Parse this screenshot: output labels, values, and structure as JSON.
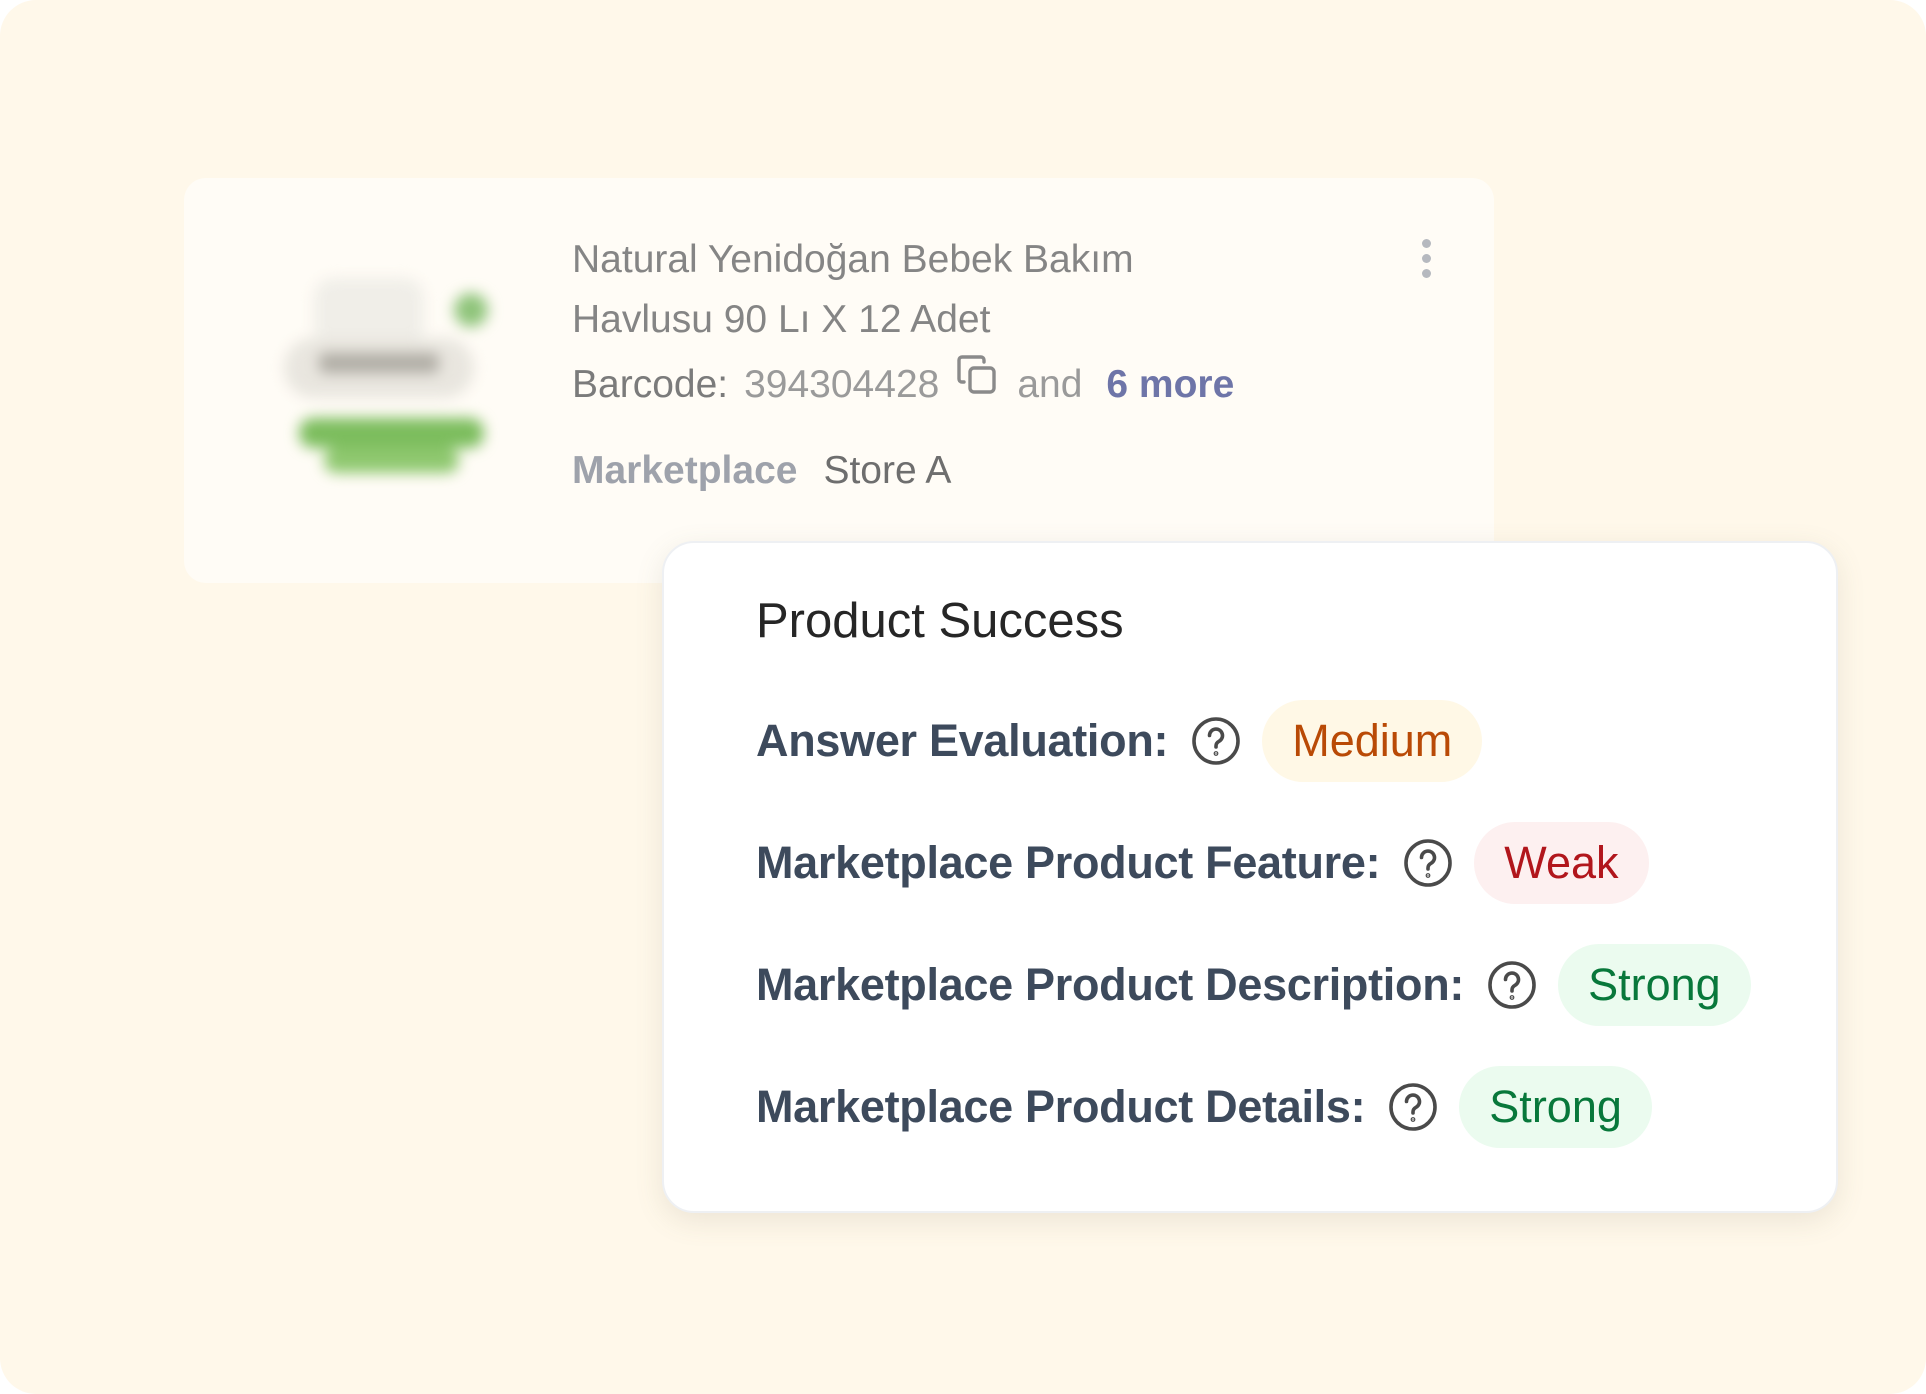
{
  "product": {
    "title_line1": "Natural Yenidoğan Bebek Bakım",
    "title_line2": "Havlusu 90 Lı X 12 Adet",
    "barcode_label": "Barcode:",
    "barcode_value": "394304428",
    "and_text": "and",
    "more_link": "6 more",
    "marketplace_label": "Marketplace",
    "marketplace_value": "Store A",
    "image_icon": "product-image",
    "menu_icon": "kebab-menu-icon",
    "copy_icon": "copy-icon"
  },
  "success": {
    "title": "Product Success",
    "metrics": [
      {
        "label": "Answer Evaluation:",
        "rating": "Medium",
        "level": "medium"
      },
      {
        "label": "Marketplace Product Feature:",
        "rating": "Weak",
        "level": "weak"
      },
      {
        "label": "Marketplace Product Description:",
        "rating": "Strong",
        "level": "strong"
      },
      {
        "label": "Marketplace Product Details:",
        "rating": "Strong",
        "level": "strong"
      }
    ],
    "help_icon": "question-circle-icon"
  },
  "colors": {
    "background": "#fff8ea",
    "medium": "#b94a06",
    "weak": "#b1161c",
    "strong": "#08783b",
    "link": "#6e75a8"
  }
}
